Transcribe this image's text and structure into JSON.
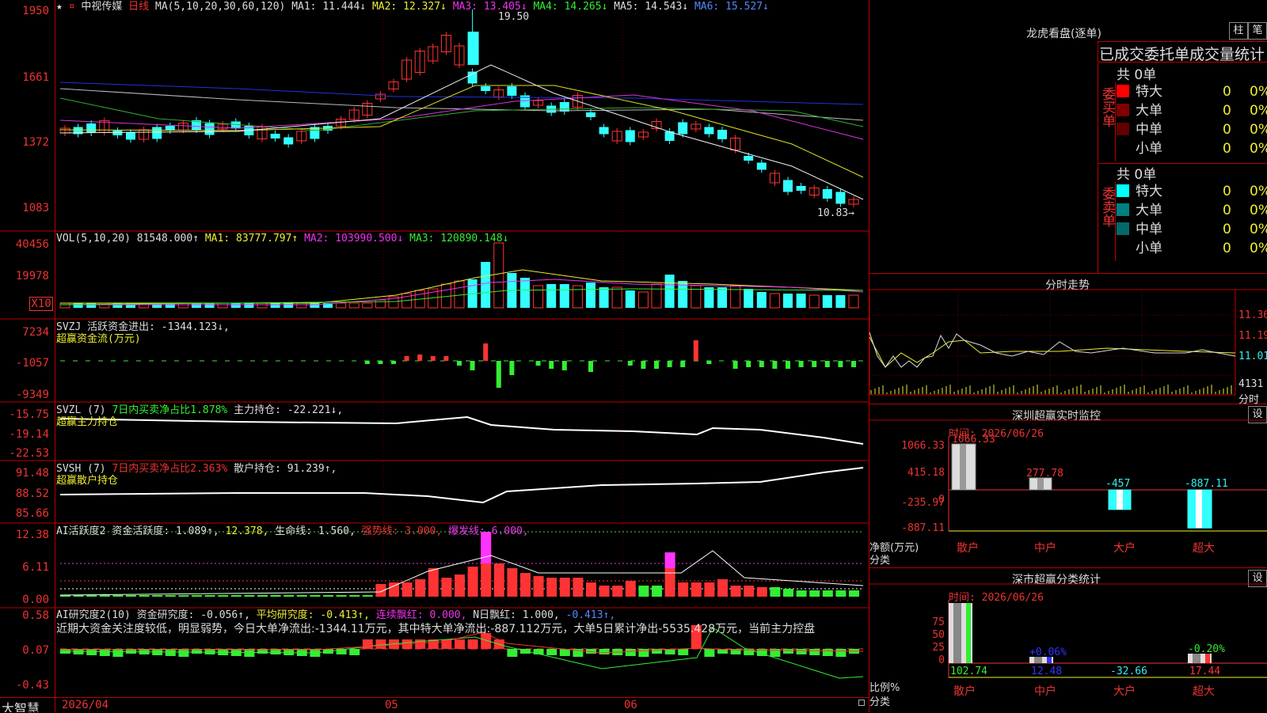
{
  "main": {
    "title_star": "★",
    "title_dot": "¤",
    "stock_name": "中视传媒",
    "period": "日线",
    "ma_legend": "MA(5,10,20,30,60,120)",
    "ma1": "MA1: 11.444↓",
    "ma2": "MA2: 12.327↓",
    "ma3": "MA3: 13.405↓",
    "ma4": "MA4: 14.265↓",
    "ma5": "MA5: 14.543↓",
    "ma6": "MA6: 15.527↓",
    "y_ticks": [
      "1950",
      "1661",
      "1372",
      "1083"
    ],
    "high_label": "19.50",
    "low_label": "10.83→",
    "colors": {
      "up": "#ff3333",
      "down": "#33ffff",
      "bg": "#000000",
      "grid": "#bb0000"
    }
  },
  "vol": {
    "legend": "VOL(5,10,20)",
    "value": "81548.000↑",
    "ma1": "MA1: 83777.797↑",
    "ma2": "MA2: 103990.500↓",
    "ma3": "MA3: 120890.148↓",
    "y_ticks": [
      "40456",
      "19978"
    ],
    "unit": "X10"
  },
  "svzj": {
    "legend": "SVZJ  活跃资金进出: -1344.123↓,",
    "sub": "超赢资金流(万元)",
    "y_ticks": [
      "7234",
      "-1057",
      "-9349"
    ]
  },
  "svzl": {
    "legend_a": "SVZL (7)",
    "legend_b": "7日内买卖净占比1.878%",
    "legend_c": "主力持仓: -22.221↓,",
    "sub": "超赢主力持仓",
    "y_ticks": [
      "-15.75",
      "-19.14",
      "-22.53"
    ]
  },
  "svsh": {
    "legend_a": "SVSH (7)",
    "legend_b": "7日内买卖净占比2.363%",
    "legend_c": "散户持仓: 91.239↑,",
    "sub": "超赢散户持仓",
    "y_ticks": [
      "91.48",
      "88.52",
      "85.66"
    ]
  },
  "ai1": {
    "legend_a": "AI活跃度2",
    "legend_b": "资金活跃度: 1.089↑,",
    "legend_c": "12.378,",
    "legend_d": "生命线: 1.560,",
    "legend_e": "强势线: 3.000,",
    "legend_f": "爆发线: 6.000,",
    "y_ticks": [
      "12.38",
      "6.11",
      "0.00"
    ]
  },
  "ai2": {
    "legend_a": "AI研究度2(10)",
    "legend_b": "资金研究度: -0.056↑,",
    "legend_c": "平均研究度: -0.413↑,",
    "legend_d": "连续飘红: 0.000,",
    "legend_e": "N日飘红: 1.000,",
    "legend_f": "-0.413↑,",
    "comment": "近期大资金关注度较低，明显弱势，今日大单净流出:-1344.11万元，其中特大单净流出:-887.112万元，大单5日累计净出-5535.428万元，当前主力控盘",
    "y_ticks": [
      "0.58",
      "0.07",
      "-0.43"
    ]
  },
  "bottom": {
    "logo": "大智慧",
    "dates": [
      "2026/04",
      "05",
      "06"
    ]
  },
  "lhb": {
    "title": "龙虎看盘(逐单)",
    "btn_zhu": "柱",
    "btn_bi": "笔",
    "header": "已成交委托单成交量统计",
    "buy_total": "共 0单",
    "buy_label": "委买单",
    "sell_total": "共 0单",
    "sell_label": "委卖单",
    "buy_rows": [
      {
        "name": "特大",
        "v1": "0",
        "v2": "0%",
        "color": "#ff0000"
      },
      {
        "name": "大单",
        "v1": "0",
        "v2": "0%",
        "color": "#800000"
      },
      {
        "name": "中单",
        "v1": "0",
        "v2": "0%",
        "color": "#600000"
      },
      {
        "name": "小单",
        "v1": "0",
        "v2": "0%",
        "color": "#000000"
      }
    ],
    "sell_rows": [
      {
        "name": "特大",
        "v1": "0",
        "v2": "0%",
        "color": "#00ffff"
      },
      {
        "name": "大单",
        "v1": "0",
        "v2": "0%",
        "color": "#008080"
      },
      {
        "name": "中单",
        "v1": "0",
        "v2": "0%",
        "color": "#006a6a"
      },
      {
        "name": "小单",
        "v1": "0",
        "v2": "0%",
        "color": "#000000"
      }
    ]
  },
  "intraday": {
    "title": "分时走势",
    "prices": [
      "11.36",
      "11.19",
      "11.01"
    ],
    "vol": "4131",
    "vol_label": "分时"
  },
  "monitor": {
    "title": "深圳超赢实时监控",
    "btn": "设",
    "time": "时间: 2026/06/26",
    "y_ticks": [
      "1066.33",
      "415.18",
      "0",
      "-235.97",
      "-887.11"
    ],
    "ylabel1": "净额(万元)",
    "ylabel2": "分类",
    "categories": [
      "散户",
      "中户",
      "大户",
      "超大"
    ],
    "values": [
      1066.33,
      277.78,
      -457,
      -887.11
    ],
    "value_labels": [
      "1066.33",
      "277.78",
      "-457",
      "-887.11"
    ]
  },
  "classify": {
    "title": "深市超赢分类统计",
    "btn": "设",
    "time": "时间: 2026/06/26",
    "y_ticks": [
      "75",
      "50",
      "25",
      "0"
    ],
    "ylabel1": "比例%",
    "ylabel2": "分类",
    "categories": [
      "散户",
      "中户",
      "大户",
      "超大"
    ],
    "bottom_values": [
      "102.74",
      "12.48",
      "-32.66",
      "17.44"
    ],
    "top_labels": [
      "",
      "+0.06%",
      "",
      "-0.20%"
    ]
  }
}
